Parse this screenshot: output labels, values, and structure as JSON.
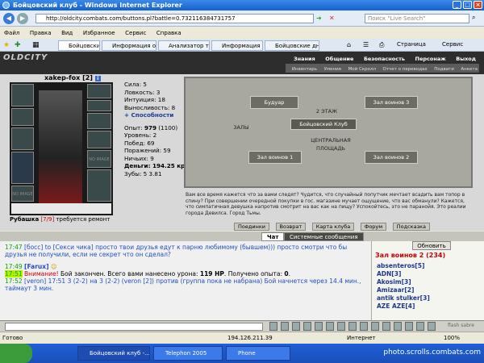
{
  "window": {
    "title": "Бойцовский клуб - Windows Internet Explorer"
  },
  "browser": {
    "url": "http://oldcity.combats.com/buttons.pl?battle=0.732116384731757",
    "search_placeholder": "Поиск \"Live Search\"",
    "menu": [
      "Файл",
      "Правка",
      "Вид",
      "Избранное",
      "Сервис",
      "Справка"
    ],
    "tabs": [
      {
        "label": "Бойцовский кл..."
      },
      {
        "label": "Информация о ..."
      },
      {
        "label": "Анализатор та..."
      },
      {
        "label": "Информация о ..."
      },
      {
        "label": "Бойцовские дн..."
      }
    ],
    "page_menu": "Страница",
    "tools_menu": "Сервис"
  },
  "game": {
    "logo": "OLDCITY",
    "topnav": [
      "Знания",
      "Общение",
      "Безопасность",
      "Персонаж",
      "Выход"
    ],
    "subnav": [
      "Инвентарь",
      "Умения",
      "Мой Скролл",
      "Отчет о переводах",
      "Подвиги",
      "Анкета"
    ]
  },
  "character": {
    "nick": "xakep-fox",
    "level": "[2]",
    "stats": [
      "Сила: 5",
      "Ловкость: 3",
      "Интуиция: 18",
      "Выносливость: 8",
      "+ Способности"
    ],
    "exp_label": "Опыт:",
    "exp_value": "979",
    "exp_next": "(1100)",
    "info": [
      "Уровень: 2",
      "Побед: 69",
      "Поражений: 59",
      "Ничьих: 9",
      "Деньги: 194.25 кр.",
      "Зубы: 5 3.81"
    ],
    "item_label": "Рубашка",
    "item_dur": "[7/9]",
    "item_note": "требуется ремонт",
    "slot_empty": "NO IMAGE"
  },
  "map": {
    "rooms": [
      "Будуар",
      "2 ЭТАЖ",
      "Бойцовский Клуб",
      "ЗАЛЫ",
      "Зал воинов 1",
      "ЦЕНТРАЛЬНАЯ ПЛОЩАДЬ",
      "Зал воинов 2",
      "Зал воинов 3"
    ],
    "text": "Вам все время кажется что за вами следят? Чудится, что случайный попутчик мечтает всадить вам топор в спину? При совершении очередной покупки в гос. магазине мучает ощущение, что вас обманули? Кажется, что симпатичная девушка напротив смотрит на вас как на пищу? Успокойтесь, это не паранойя. Это реалии города Девилса. Город Тьмы.",
    "buttons": [
      "Поединки",
      "Возврат",
      "Карта клуба",
      "Форум",
      "Подсказка"
    ]
  },
  "chat_tabs": [
    "Чат",
    "Системные сообщения"
  ],
  "chat": [
    {
      "time": "17:47",
      "nick": "[босс]",
      "to": "to [Секси чика]",
      "text": "просто твои друзья едут к парню любимому (бывшем))) просто смотри что бы друзья не получили, если не секрет что он сделал?"
    },
    {
      "time": "17:49",
      "nick": "[Farux]"
    },
    {
      "time": "17:51",
      "warn": "Внимание!",
      "text": "Бой закончен. Всего вами нанесено урона:",
      "dmg": "119 HP",
      "exp_text": ". Получено опыта:",
      "exp": "0"
    },
    {
      "time": "17:52",
      "nick": "[veron]",
      "text": "17:51 3 (2-2) на 3 (2-2) (veron [2]) против (группа пока не набрана) Бой начнется через 14.4 мин., таймаут 3 мин."
    }
  ],
  "sidebar": {
    "refresh": "Обновить",
    "location": "Зал воинов 2 (234)",
    "players": [
      "absenteros[5]",
      "ADN[3]",
      "Akosim[3]",
      "Amizaar[2]",
      "antik stulker[3]",
      "AZE AZE[4]"
    ],
    "flash": "flash sabre"
  },
  "status": {
    "left": "Готово",
    "ip": "194.126.211.39",
    "zone": "Интернет",
    "zoom": "100%"
  },
  "taskbar": {
    "tasks": [
      "Бойцовский клуб -...",
      "Telephon 2005",
      "Phone"
    ],
    "watermark": "photo.scrolls.combats.com"
  }
}
